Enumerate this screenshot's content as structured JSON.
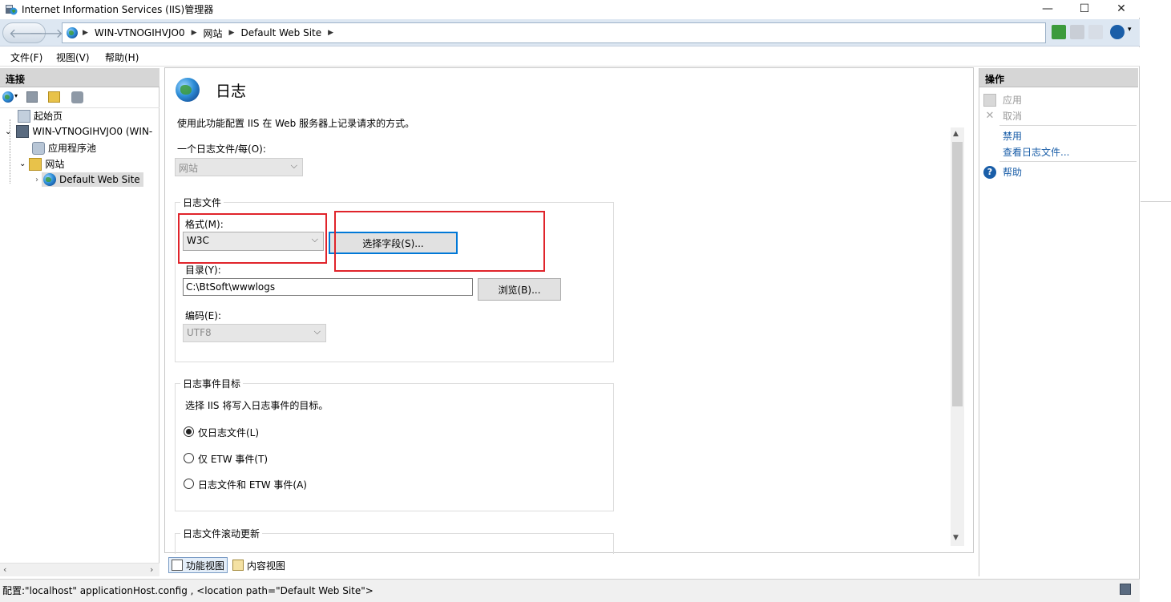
{
  "window": {
    "title": "Internet Information Services (IIS)管理器",
    "controls": {
      "minimize": "—",
      "maximize": "☐",
      "close": "✕"
    }
  },
  "breadcrumb": [
    "WIN-VTNOGIHVJO0",
    "网站",
    "Default Web Site"
  ],
  "menu": [
    "文件(F)",
    "视图(V)",
    "帮助(H)"
  ],
  "connections": {
    "header": "连接",
    "tree": [
      {
        "label": "起始页",
        "icon": "start-page-icon"
      },
      {
        "label": "WIN-VTNOGIHVJO0 (WIN-",
        "icon": "server-icon"
      },
      {
        "label": "应用程序池",
        "icon": "app-pool-icon"
      },
      {
        "label": "网站",
        "icon": "sites-folder-icon"
      },
      {
        "label": "Default Web Site",
        "icon": "globe-icon"
      }
    ]
  },
  "feature": {
    "title": "日志",
    "description": "使用此功能配置 IIS 在 Web 服务器上记录请求的方式。",
    "one_log_label": "一个日志文件/每(O):",
    "one_log_value": "网站",
    "log_file_group": "日志文件",
    "format_label": "格式(M):",
    "format_value": "W3C",
    "select_fields_button": "选择字段(S)...",
    "directory_label": "目录(Y):",
    "directory_value": "C:\\BtSoft\\wwwlogs",
    "browse_button": "浏览(B)...",
    "encoding_label": "编码(E):",
    "encoding_value": "UTF8",
    "event_group": "日志事件目标",
    "event_desc": "选择 IIS 将写入日志事件的目标。",
    "radio_options": [
      "仅日志文件(L)",
      "仅 ETW 事件(T)",
      "日志文件和 ETW 事件(A)"
    ],
    "selected_radio": 0,
    "rollover_group": "日志文件滚动更新"
  },
  "bottom_tabs": [
    "功能视图",
    "内容视图"
  ],
  "actions": {
    "header": "操作",
    "apply": "应用",
    "cancel": "取消",
    "disable": "禁用",
    "view_logs": "查看日志文件...",
    "help": "帮助"
  },
  "status": "配置:\"localhost\" applicationHost.config , <location path=\"Default Web Site\">",
  "colors": {
    "accent": "#0078d7",
    "highlight": "#e0242b",
    "link": "#1a5ea8"
  }
}
